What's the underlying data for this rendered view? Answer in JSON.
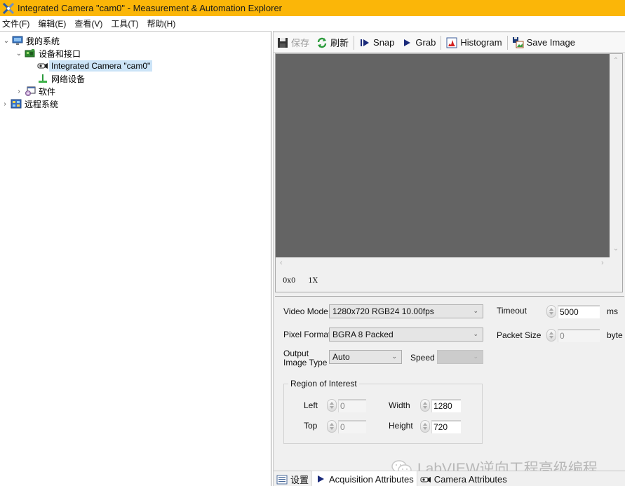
{
  "window": {
    "title": "Integrated Camera  \"cam0\" - Measurement & Automation Explorer",
    "accent_color": "#fbb608"
  },
  "menubar": {
    "items": [
      {
        "label": "文件(F)"
      },
      {
        "label": "编辑(E)"
      },
      {
        "label": "查看(V)"
      },
      {
        "label": "工具(T)"
      },
      {
        "label": "帮助(H)"
      }
    ]
  },
  "tree": {
    "items": [
      {
        "label": "我的系统",
        "icon": "computer-icon",
        "expanded": true,
        "level": 0
      },
      {
        "label": "设备和接口",
        "icon": "devices-icon",
        "expanded": true,
        "level": 1
      },
      {
        "label": "Integrated Camera  \"cam0\"",
        "icon": "camera-icon",
        "selected": true,
        "level": 2
      },
      {
        "label": "网络设备",
        "icon": "network-icon",
        "level": 2
      },
      {
        "label": "软件",
        "icon": "software-icon",
        "expanded": false,
        "level": 1
      },
      {
        "label": "远程系统",
        "icon": "remote-systems-icon",
        "expanded": false,
        "level": 0
      }
    ]
  },
  "toolbar": {
    "save_label": "保存",
    "refresh_label": "刷新",
    "snap_label": "Snap",
    "grab_label": "Grab",
    "histogram_label": "Histogram",
    "save_image_label": "Save Image"
  },
  "viewer": {
    "coords": "0x0",
    "zoom": "1X"
  },
  "settings": {
    "video_mode": {
      "label": "Video Mode",
      "value": "1280x720 RGB24 10.00fps"
    },
    "pixel_format": {
      "label": "Pixel Format",
      "value": "BGRA 8 Packed"
    },
    "output_image_type": {
      "label_line1": "Output",
      "label_line2": "Image Type",
      "value": "Auto"
    },
    "speed": {
      "label": "Speed",
      "value": ""
    },
    "timeout": {
      "label": "Timeout",
      "value": "5000",
      "unit": "ms"
    },
    "packet_size": {
      "label": "Packet Size",
      "value": "0",
      "unit": "byte"
    },
    "roi": {
      "title": "Region of Interest",
      "left": {
        "label": "Left",
        "value": "0"
      },
      "top": {
        "label": "Top",
        "value": "0"
      },
      "width": {
        "label": "Width",
        "value": "1280"
      },
      "height": {
        "label": "Height",
        "value": "720"
      }
    }
  },
  "watermark": {
    "text": "LabVIEW逆向工程高级编程"
  },
  "tabs": [
    {
      "label": "设置",
      "active": false
    },
    {
      "label": "Acquisition Attributes",
      "active": true
    },
    {
      "label": "Camera Attributes",
      "active": false
    }
  ]
}
